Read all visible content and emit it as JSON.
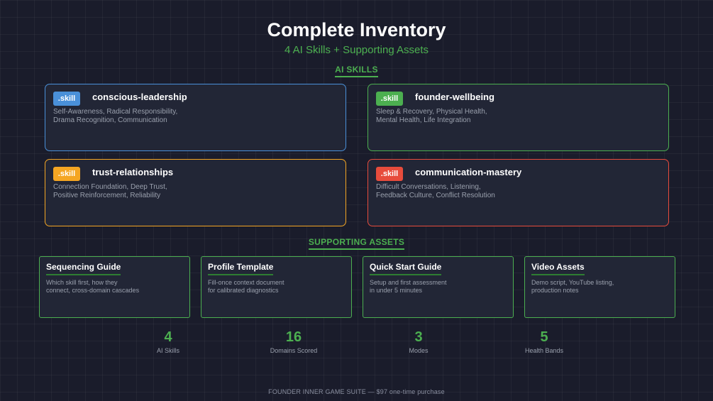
{
  "header": {
    "title": "Complete Inventory",
    "subtitle": "4 AI Skills + Supporting Assets"
  },
  "skills_section": {
    "heading": "AI SKILLS",
    "cards": [
      {
        "badge": ".skill",
        "name": "conscious-leadership",
        "desc_line1": "Self-Awareness, Radical Responsibility,",
        "desc_line2": "Drama Recognition, Communication",
        "color": "#4a90d9"
      },
      {
        "badge": ".skill",
        "name": "founder-wellbeing",
        "desc_line1": "Sleep & Recovery, Physical Health,",
        "desc_line2": "Mental Health, Life Integration",
        "color": "#4caf50"
      },
      {
        "badge": ".skill",
        "name": "trust-relationships",
        "desc_line1": "Connection Foundation, Deep Trust,",
        "desc_line2": "Positive Reinforcement, Reliability",
        "color": "#f5a623"
      },
      {
        "badge": ".skill",
        "name": "communication-mastery",
        "desc_line1": "Difficult Conversations, Listening,",
        "desc_line2": "Feedback Culture, Conflict Resolution",
        "color": "#e74c3c"
      }
    ]
  },
  "assets_section": {
    "heading": "SUPPORTING ASSETS",
    "cards": [
      {
        "title": "Sequencing Guide",
        "desc_line1": "Which skill first, how they",
        "desc_line2": "connect, cross-domain cascades"
      },
      {
        "title": "Profile Template",
        "desc_line1": "Fill-once context document",
        "desc_line2": "for calibrated diagnostics"
      },
      {
        "title": "Quick Start Guide",
        "desc_line1": "Setup and first assessment",
        "desc_line2": "in under 5 minutes"
      },
      {
        "title": "Video Assets",
        "desc_line1": "Demo script, YouTube listing,",
        "desc_line2": "production notes"
      }
    ]
  },
  "stats": [
    {
      "value": "4",
      "label": "AI Skills"
    },
    {
      "value": "16",
      "label": "Domains Scored"
    },
    {
      "value": "3",
      "label": "Modes"
    },
    {
      "value": "5",
      "label": "Health Bands"
    }
  ],
  "footer": {
    "text": "FOUNDER INNER GAME SUITE  —  $97 one-time purchase"
  },
  "colors": {
    "background": "#1a1c2b",
    "accent_green": "#4caf50",
    "card_background": "#222636"
  }
}
